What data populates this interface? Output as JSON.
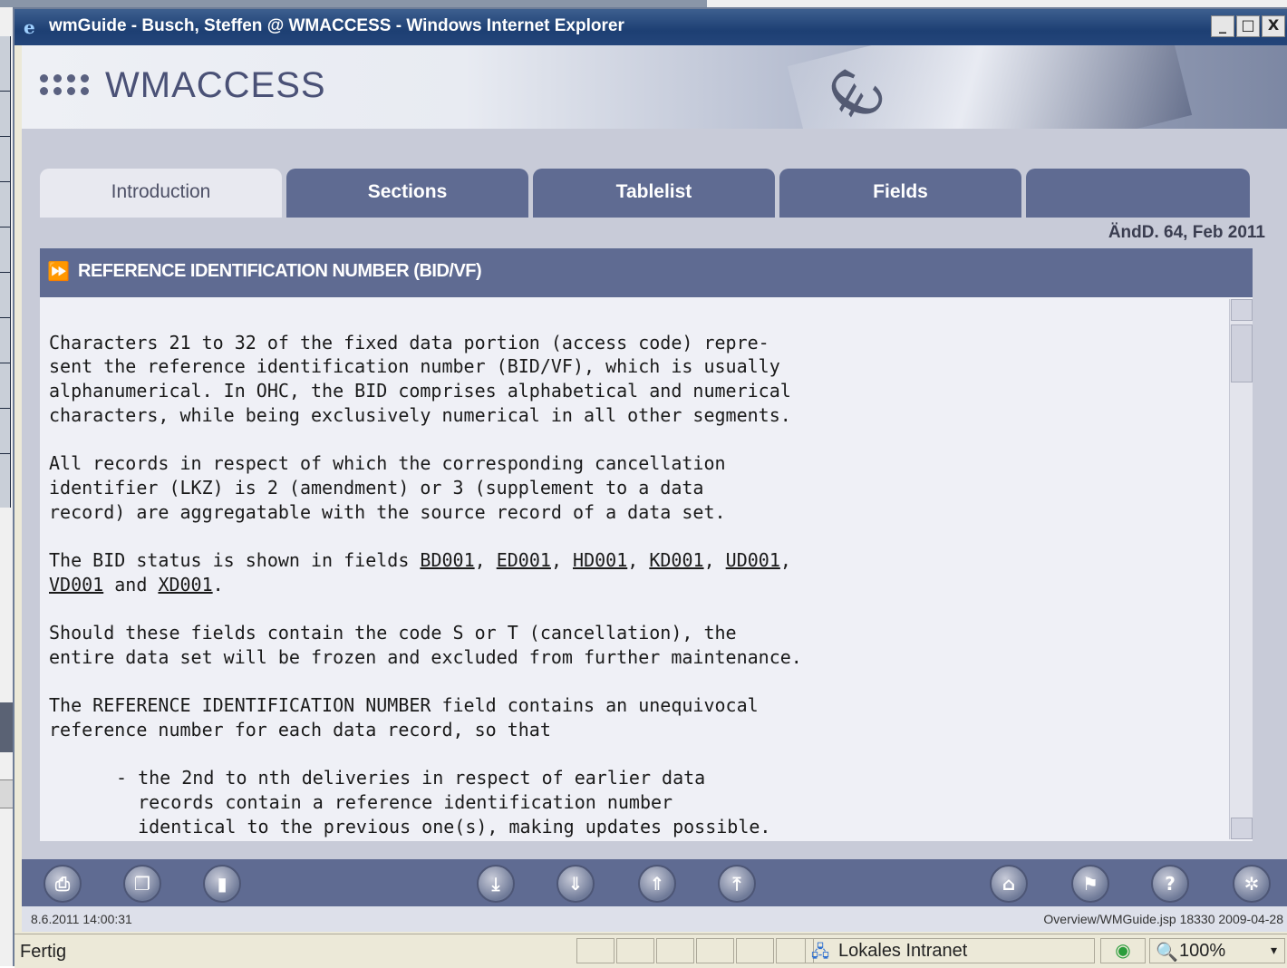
{
  "window": {
    "title": "wmGuide - Busch, Steffen @ WMACCESS - Windows Internet Explorer",
    "minimize": "_",
    "maximize": "□",
    "close": "X"
  },
  "header": {
    "logo": "WMACCESS"
  },
  "tabs": [
    {
      "label": "Introduction"
    },
    {
      "label": "Sections"
    },
    {
      "label": "Tablelist"
    },
    {
      "label": "Fields"
    },
    {
      "label": ""
    }
  ],
  "revision": "ÄndD. 64, Feb 2011",
  "section": {
    "title": "REFERENCE IDENTIFICATION NUMBER (BID/VF)"
  },
  "content": {
    "p1": "Characters 21 to 32 of the fixed data portion (access code) repre-\nsent the reference identification number (BID/VF), which is usually\nalphanumerical. In OHC, the BID comprises alphabetical and numerical\ncharacters, while being exclusively numerical in all other segments.",
    "p2": "All records in respect of which the corresponding cancellation\nidentifier (LKZ) is 2 (amendment) or 3 (supplement to a data\nrecord) are aggregatable with the source record of a data set.",
    "p3_intro": "The BID status is shown in fields ",
    "links": [
      "BD001",
      "ED001",
      "HD001",
      "KD001",
      "UD001",
      "VD001",
      "XD001"
    ],
    "p3_and": " and ",
    "p4": "Should these fields contain the code S or T (cancellation), the\nentire data set will be frozen and excluded from further maintenance.",
    "p5": "The REFERENCE IDENTIFICATION NUMBER field contains an unequivocal\nreference number for each data record, so that",
    "bullet": "- the 2nd to nth deliveries in respect of earlier data\n  records contain a reference identification number\n  identical to the previous one(s), making updates possible."
  },
  "toolbar": {
    "icons": [
      "print-icon",
      "copy-icon",
      "book-icon",
      "last-page-icon",
      "next-page-icon",
      "previous-page-icon",
      "first-page-icon",
      "home-icon",
      "bookmark-icon",
      "help-icon",
      "settings-icon"
    ]
  },
  "info": {
    "datetime": "8.6.2011 14:00:31",
    "path": "Overview/WMGuide.jsp 18330 2009-04-28"
  },
  "status": {
    "left": "Fertig",
    "zone": "Lokales Intranet",
    "zoom": "100%"
  }
}
